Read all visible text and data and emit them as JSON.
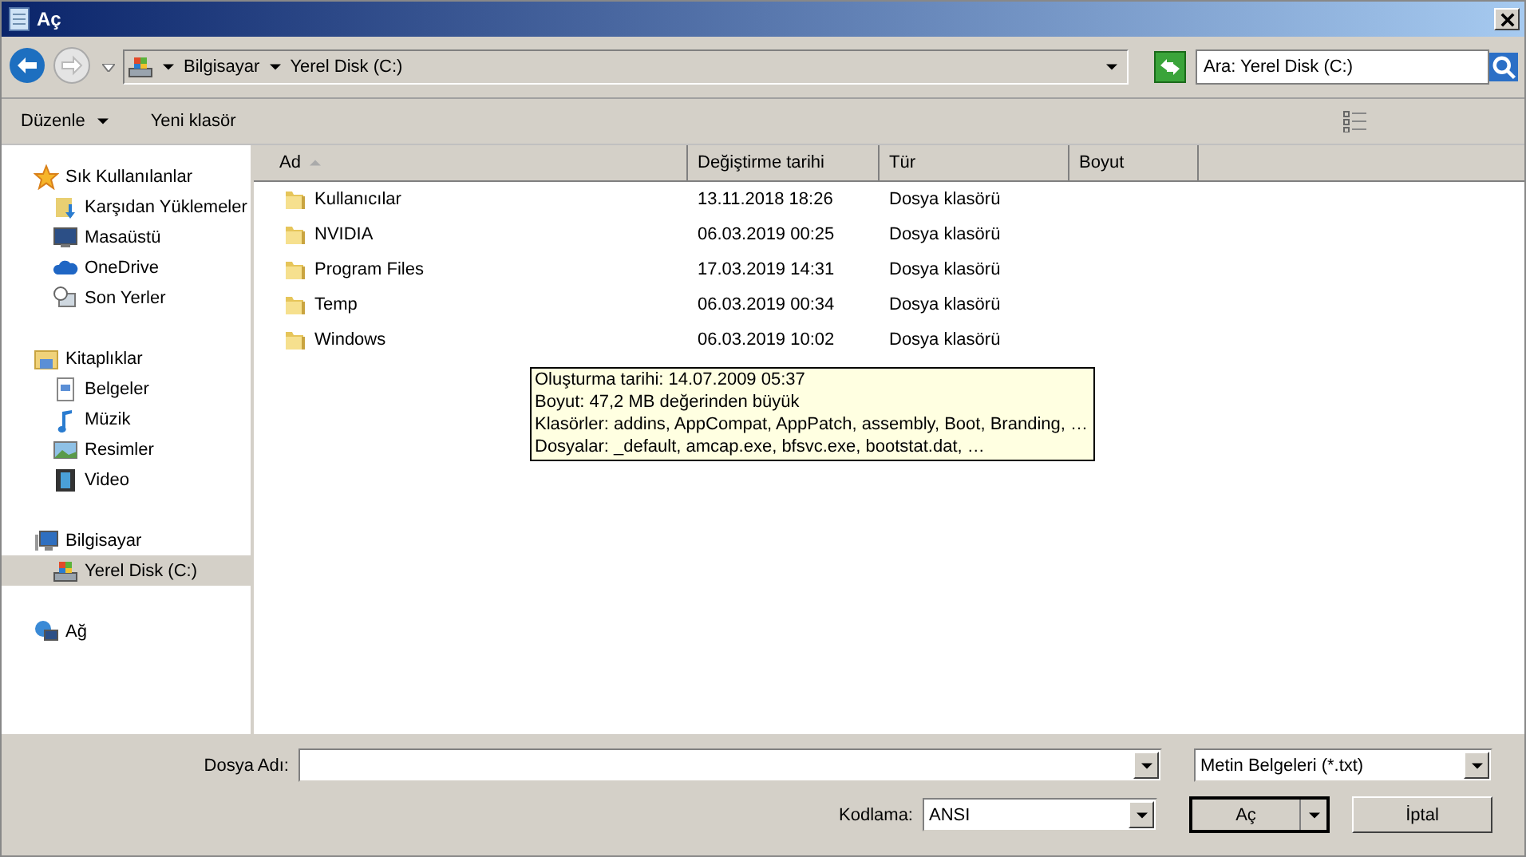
{
  "window": {
    "title": "Aç"
  },
  "breadcrumb": [
    "Bilgisayar",
    "Yerel Disk (C:)"
  ],
  "search": {
    "placeholder": "Ara: Yerel Disk (C:)"
  },
  "toolbar": [
    {
      "label": "Düzenle",
      "kind": "menu"
    },
    {
      "label": "Yeni klasör",
      "kind": "button"
    }
  ],
  "sidebar": {
    "groups": [
      {
        "label": "Sık Kullanılanlar",
        "kind": "star",
        "selected": false,
        "children": [
          {
            "label": "Karşıdan Yüklemeler",
            "kind": "downloads",
            "selected": false
          },
          {
            "label": "Masaüstü",
            "kind": "desktop",
            "selected": false
          },
          {
            "label": "OneDrive",
            "kind": "cloud",
            "selected": false
          },
          {
            "label": "Son Yerler",
            "kind": "recent",
            "selected": false
          }
        ]
      },
      {
        "label": "Kitaplıklar",
        "kind": "library",
        "selected": false,
        "children": [
          {
            "label": "Belgeler",
            "kind": "document",
            "selected": false
          },
          {
            "label": "Müzik",
            "kind": "music",
            "selected": false
          },
          {
            "label": "Resimler",
            "kind": "pictures",
            "selected": false
          },
          {
            "label": "Video",
            "kind": "video",
            "selected": false
          }
        ]
      },
      {
        "label": "Bilgisayar",
        "kind": "computer",
        "selected": false,
        "children": [
          {
            "label": "Yerel Disk (C:)",
            "kind": "disk",
            "selected": true
          }
        ]
      },
      {
        "label": "Ağ",
        "kind": "network",
        "selected": false
      }
    ]
  },
  "table": {
    "columns": [
      {
        "label": "Ad",
        "sorted": true
      },
      {
        "label": "Değiştirme tarihi",
        "sorted": false
      },
      {
        "label": "Tür",
        "sorted": false
      },
      {
        "label": "Boyut",
        "sorted": false
      }
    ],
    "rows": [
      {
        "name": "Kullanıcılar",
        "modified": "13.11.2018 18:26",
        "type": "Dosya klasörü"
      },
      {
        "name": "NVIDIA",
        "modified": "06.03.2019 00:25",
        "type": "Dosya klasörü"
      },
      {
        "name": "Program Files",
        "modified": "17.03.2019 14:31",
        "type": "Dosya klasörü"
      },
      {
        "name": "Temp",
        "modified": "06.03.2019 00:34",
        "type": "Dosya klasörü"
      },
      {
        "name": "Windows",
        "modified": "06.03.2019 10:02",
        "type": "Dosya klasörü"
      }
    ]
  },
  "tooltip": [
    "Oluşturma tarihi: 14.07.2009 05:37",
    "Boyut: 47,2 MB değerinden büyük",
    "Klasörler: addins, AppCompat, AppPatch, assembly, Boot, Branding, …",
    "Dosyalar: _default, amcap.exe, bfsvc.exe, bootstat.dat, …"
  ],
  "footer": {
    "filename": {
      "label": "Dosya Adı:"
    },
    "filter": {
      "value": "Metin Belgeleri (*.txt)"
    },
    "encoding": {
      "label": "Kodlama:",
      "value": "ANSI"
    },
    "buttons": [
      {
        "label": "Aç",
        "kind": "split"
      },
      {
        "label": "İptal",
        "kind": "plain"
      }
    ]
  }
}
